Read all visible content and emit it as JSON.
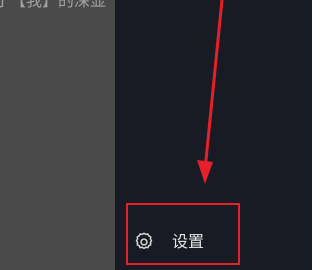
{
  "background_caption": "丁【我】的深显",
  "sidebar": {
    "settings": {
      "label": "设置",
      "icon": "gear-icon"
    }
  },
  "annotation": {
    "color": "#e5202a"
  }
}
